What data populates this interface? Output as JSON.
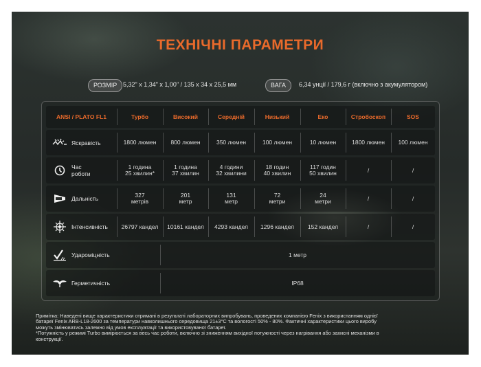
{
  "title": "ТЕХНІЧНІ ПАРАМЕТРИ",
  "size": {
    "label": "РОЗМІР",
    "value": "5,32\" x 1,34\" x 1,00\" / 135 x 34 x 25,5 мм"
  },
  "weight": {
    "label": "ВАГА",
    "value": "6,34 унції / 179,6 г (включно з акумулятором)"
  },
  "table": {
    "header": [
      "ANSI / PLATO FL1",
      "Турбо",
      "Високий",
      "Середній",
      "Низький",
      "Еко",
      "Стробоскоп",
      "SOS"
    ],
    "rows": [
      {
        "icon": "brightness-icon",
        "label": "Яскравість",
        "values": [
          "1800 люмен",
          "800 люмен",
          "350 люмен",
          "100 люмен",
          "10 люмен",
          "1800 люмен",
          "100 люмен"
        ]
      },
      {
        "icon": "clock-icon",
        "label_line1": "Час",
        "label_line2": "роботи",
        "values": [
          [
            "1 година",
            "25 хвилин*"
          ],
          [
            "1 година",
            "37 хвилин"
          ],
          [
            "4 години",
            "32 хвилини"
          ],
          [
            "18 годин",
            "40 хвилин"
          ],
          [
            "117 годин",
            "50 хвилин"
          ],
          [
            "/"
          ],
          [
            "/"
          ]
        ]
      },
      {
        "icon": "distance-icon",
        "label": "Дальність",
        "values": [
          [
            "327",
            "метрів"
          ],
          [
            "201",
            "метр"
          ],
          [
            "131",
            "метр"
          ],
          [
            "72",
            "метри"
          ],
          [
            "24",
            "метри"
          ],
          [
            "/"
          ],
          [
            "/"
          ]
        ]
      },
      {
        "icon": "intensity-icon",
        "label": "Інтенсивність",
        "values": [
          "26797 кандел",
          "10161 кандел",
          "4293 кандел",
          "1296 кандел",
          "152 кандел",
          "/",
          "/"
        ]
      },
      {
        "icon": "impact-icon",
        "label": "Удароміцність",
        "value": "1 метр"
      },
      {
        "icon": "waterproof-icon",
        "label": "Герметичність",
        "value": "IP68"
      }
    ]
  },
  "notes": [
    "Примітка: Наведені вище характеристики отримані в результаті лабораторних випробувань, проведених компанією Fenix з використанням однієї",
    "батареї Fenix ARB-L18-2600 за температури навколишнього середовища 21±3°C та вологості 50% - 80%. Фактичні характеристики цього виробу",
    "можуть змінюватись залежно від умов експлуатації та використовуваної батареї.",
    "*Потужність у режимі Turbo вимірюється за весь час роботи, включно зі зниженням вихідної потужності через нагрівання або захисні механізми в",
    "конструкції."
  ]
}
